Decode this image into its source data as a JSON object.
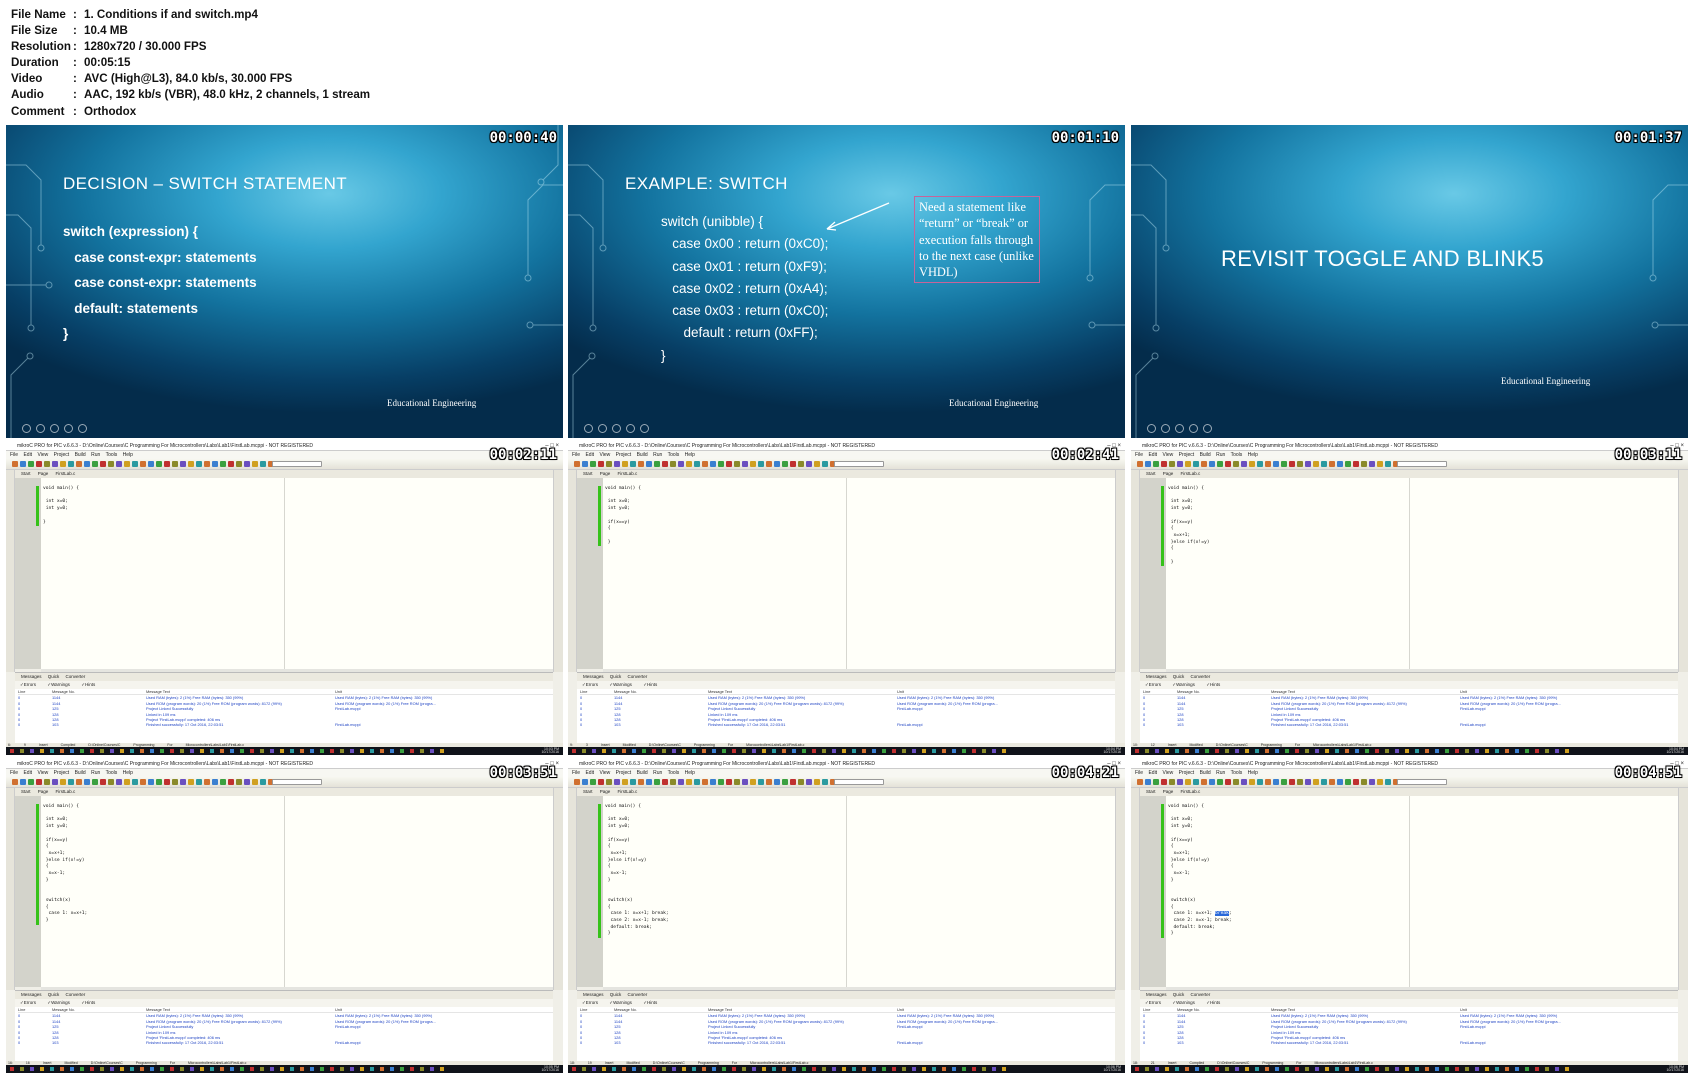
{
  "header": {
    "rows": [
      {
        "key": "File Name",
        "value": "1. Conditions if and switch.mp4"
      },
      {
        "key": "File Size",
        "value": "10.4 MB"
      },
      {
        "key": "Resolution",
        "value": "1280x720 / 30.000 FPS"
      },
      {
        "key": "Duration",
        "value": "00:05:15"
      },
      {
        "key": "Video",
        "value": "AVC (High@L3), 84.0 kb/s, 30.000 FPS"
      },
      {
        "key": "Audio",
        "value": "AAC, 192 kb/s (VBR), 48.0 kHz, 2 channels, 1 stream"
      },
      {
        "key": "Comment",
        "value": "Orthodox"
      }
    ]
  },
  "slides": [
    {
      "timestamp": "00:00:40",
      "title": "DECISION – SWITCH STATEMENT",
      "lines": [
        "switch (expression) {",
        "   case const-expr: statements",
        "   case const-expr: statements",
        "   default: statements",
        "}"
      ],
      "footer": "Educational Engineering"
    },
    {
      "timestamp": "00:01:10",
      "title": "EXAMPLE: SWITCH",
      "lines": [
        "switch (unibble) {",
        "   case 0x00 : return (0xC0);",
        "   case 0x01 : return (0xF9);",
        "   case 0x02 : return (0xA4);",
        "   case 0x03 : return (0xC0);",
        "      default : return (0xFF);",
        "}"
      ],
      "note": "Need a statement like “return” or “break” or execution falls through to the next case (unlike VHDL)",
      "footer": "Educational Engineering"
    },
    {
      "timestamp": "00:01:37",
      "title": "REVISIT TOGGLE AND BLINK5",
      "footer": "Educational Engineering"
    }
  ],
  "ide": {
    "title": "mikroC PRO for PIC v.6.6.3 - D:\\Online\\Courses\\C Programming For Microcontrollers\\Labs\\Lab1\\FirstLab.mcppi - NOT REGISTERED",
    "menu": [
      "File",
      "Edit",
      "View",
      "Project",
      "Build",
      "Run",
      "Tools",
      "Help"
    ],
    "tabs": [
      "Start Page",
      "FirstLab.c"
    ],
    "msg_tabs": [
      "Messages",
      "Quick Converter"
    ],
    "msg_opts": [
      "Errors",
      "Warnings",
      "Hints"
    ],
    "msg_header": [
      "Line",
      "Message No.",
      "Message Text",
      "Unit"
    ],
    "msg_rows": [
      [
        "0",
        "1144",
        "Used RAM (bytes): 2 (1%)  Free RAM (bytes): 350 (99%)",
        "Used RAM (bytes): 2 (1%)  Free RAM (bytes): 350 (99%)"
      ],
      [
        "0",
        "1144",
        "Used ROM (program words): 20 (1%)  Free ROM (program words): 8172 (99%)",
        "Used ROM (program words): 20 (1%)  Free ROM (progra..."
      ],
      [
        "0",
        "125",
        "Project Linked Successfully",
        "FirstLab.mcppi"
      ],
      [
        "0",
        "128",
        "Linked in 109 ms",
        ""
      ],
      [
        "0",
        "128",
        "Project 'FirstLab.mcppi' completed: 406 ms",
        ""
      ],
      [
        "0",
        "103",
        "Finished successfully: 17 Oct 2016, 22:03:51",
        "FirstLab.mcppi"
      ]
    ],
    "status_path": "D:\\Online\\Courses\\C Programming For Microcontrollers\\Labs\\Lab1\\FirstLab.c",
    "clock_date": "10/17/2016"
  },
  "ide_frames": [
    {
      "timestamp": "00:02:11",
      "status": [
        "6: 9",
        "Insert",
        "Compiled"
      ],
      "clock": "10:03 PM",
      "code": [
        "void main() {",
        "",
        " int x=0;",
        " int y=0;",
        "",
        "}"
      ]
    },
    {
      "timestamp": "00:02:41",
      "status": [
        "9: 3",
        "Insert",
        "Modified"
      ],
      "clock": "10:04 PM",
      "code": [
        "void main() {",
        "",
        " int x=0;",
        " int y=0;",
        "",
        " if(x==y)",
        " {",
        "",
        " }"
      ]
    },
    {
      "timestamp": "00:03:11",
      "status": [
        "10: 12",
        "Insert",
        "Modified"
      ],
      "clock": "10:04 PM",
      "code": [
        "void main() {",
        "",
        " int x=0;",
        " int y=0;",
        "",
        " if(x==y)",
        " {",
        "  x=x+1;",
        " }else if(x!=y)",
        " {",
        "",
        " }"
      ]
    },
    {
      "timestamp": "00:03:51",
      "status": [
        "16: 16",
        "Insert",
        "Modified"
      ],
      "clock": "10:05 PM",
      "code": [
        "void main() {",
        "",
        " int x=0;",
        " int y=0;",
        "",
        " if(x==y)",
        " {",
        "  x=x+1;",
        " }else if(x!=y)",
        " {",
        "  x=x-1;",
        " }",
        "",
        "",
        " switch(x)",
        " {",
        "  case 1: x=x+1;",
        " }"
      ]
    },
    {
      "timestamp": "00:04:21",
      "status": [
        "18: 19",
        "Insert",
        "Modified"
      ],
      "clock": "10:06 PM",
      "code": [
        "void main() {",
        "",
        " int x=0;",
        " int y=0;",
        "",
        " if(x==y)",
        " {",
        "  x=x+1;",
        " }else if(x!=y)",
        " {",
        "  x=x-1;",
        " }",
        "",
        "",
        " switch(x)",
        " {",
        "  case 1: x=x+1; break;",
        "  case 2: x=x-1; break;",
        "  default: break;",
        " }"
      ]
    },
    {
      "timestamp": "00:04:51",
      "status": [
        "18: 21",
        "Insert",
        "Compiled"
      ],
      "clock": "10:06 PM",
      "code": [
        "void main() {",
        "",
        " int x=0;",
        " int y=0;",
        "",
        " if(x==y)",
        " {",
        "  x=x+1;",
        " }else if(x!=y)",
        " {",
        "  x=x-1;",
        " }",
        "",
        "",
        " switch(x)",
        " {",
        "  case 1: x=x+1; break;",
        "  case 2: x=x-1; break;",
        "  default: break;",
        " }"
      ]
    }
  ]
}
